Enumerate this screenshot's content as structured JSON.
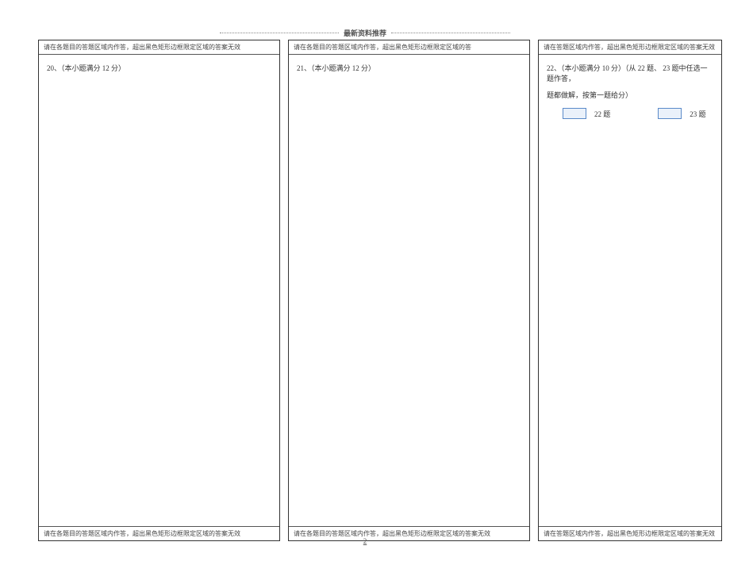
{
  "header": "最新资料推荐",
  "note_top_1": "请在各题目的答题区域内作答，超出黑色矩形边框限定区域的答案无效",
  "note_top_2": "请在各题目的答题区域内作答，超出黑色矩形边框限定区域的答",
  "note_top_3": "请在答题区域内作答，超出黑色矩形边框限定区域的答案无效",
  "note_bottom_1": "请在各题目的答题区域内作答，超出黑色矩形边框限定区域的答案无效",
  "note_bottom_2": "请在各题目的答题区域内作答，超出黑色矩形边框限定区域的答案无效",
  "note_bottom_3": "请在答题区域内作答，超出黑色矩形边框限定区域的答案无效",
  "q20": "20、（本小题满分  12 分）",
  "q21": "21、（本小题满分  12 分）",
  "q22_line1": "22、（本小题满分  10 分）（从 22 题、 23 题中任选一题作答，",
  "q22_line2": "题都做解，按第一题给分）",
  "checkbox1_label": "22 题",
  "checkbox2_label": "23 题",
  "page_number": "2"
}
